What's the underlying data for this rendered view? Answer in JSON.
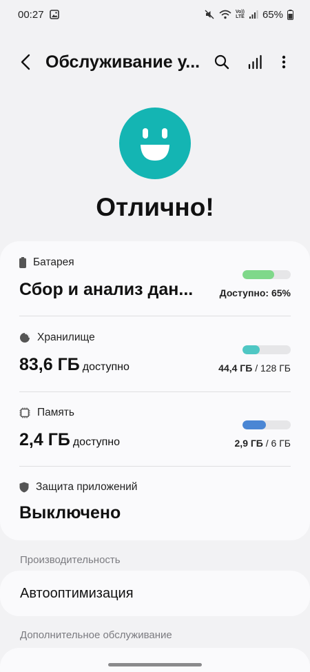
{
  "status_bar": {
    "time": "00:27",
    "volte_top": "Vo))",
    "volte_bottom": "LTE",
    "battery_percent": "65%"
  },
  "app_bar": {
    "title": "Обслуживание у..."
  },
  "hero": {
    "status": "Отлично!",
    "face_color": "#14b5b3"
  },
  "battery": {
    "label": "Батарея",
    "value": "Сбор и анализ дан...",
    "info": "Доступно: 65%",
    "level": 0.65,
    "bar_color": "#7fd88a"
  },
  "storage": {
    "label": "Хранилище",
    "value": "83,6 ГБ",
    "unit": "доступно",
    "used": "44,4 ГБ",
    "total": "/ 128 ГБ",
    "level": 0.35,
    "bar_color": "#4fc7c4"
  },
  "memory": {
    "label": "Память",
    "value": "2,4 ГБ",
    "unit": "доступно",
    "used": "2,9 ГБ",
    "total": "/ 6 ГБ",
    "level": 0.48,
    "bar_color": "#4a86d4"
  },
  "app_protection": {
    "label": "Защита приложений",
    "value": "Выключено"
  },
  "performance": {
    "heading": "Производительность",
    "auto_optimization": "Автооптимизация"
  },
  "additional": {
    "heading": "Дополнительное обслуживание"
  }
}
